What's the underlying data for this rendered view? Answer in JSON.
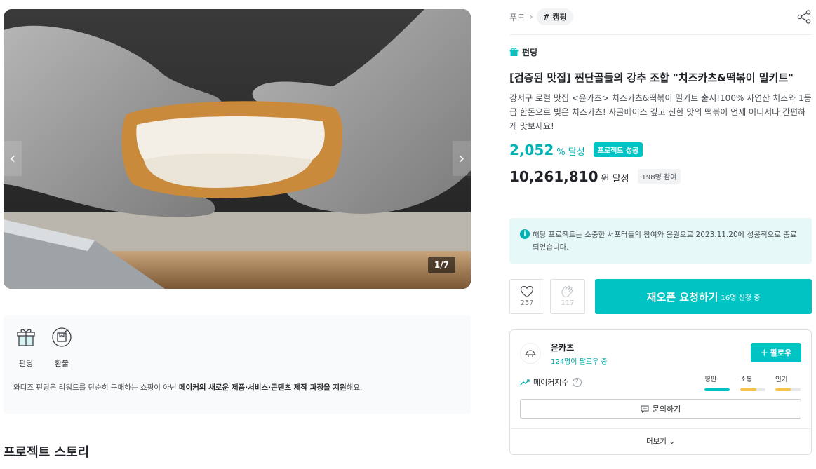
{
  "gallery": {
    "counter": "1/7",
    "prev_icon": "chevron-left-icon",
    "next_icon": "chevron-right-icon"
  },
  "info_box": {
    "icons": [
      {
        "label": "펀딩",
        "icon": "gift-icon"
      },
      {
        "label": "환불",
        "icon": "refund-icon"
      }
    ],
    "text_before": "와디즈 펀딩은 리워드를 단순히 구매하는 쇼핑이 아닌 ",
    "text_bold": "메이커의 새로운 제품·서비스·콘텐츠 제작 과정을 지원",
    "text_after": "해요."
  },
  "story_title": "프로젝트 스토리",
  "breadcrumb": {
    "category": "푸드",
    "tag": "# 캠핑"
  },
  "funding_label": "펀딩",
  "product": {
    "title": "[검증된 맛집] 찐단골들의 강추 조합 \"치즈카츠&떡볶이 밀키트\"",
    "description": "강서구 로컬 맛집 <윤카츠> 치즈카츠&떡볶이 밀키트 출시!100% 자연산 치즈와 1등급 한돈으로 빚은 치즈카츠! 사골베이스 깊고 진한 맛의 떡볶이 언제 어디서나 간편하게 맛보세요!"
  },
  "stats": {
    "percent_value": "2,052",
    "percent_unit": "% 달성",
    "success_badge": "프로젝트 성공",
    "amount_value": "10,261,810",
    "amount_unit": "원 달성",
    "participants": "198명 참여"
  },
  "notice": {
    "text": "해당 프로젝트는 소중한 서포터들의 참여와 응원으로 2023.11.20에 성공적으로 종료되었습니다."
  },
  "actions": {
    "like_count": "257",
    "cheer_count": "117",
    "rerun_label": "재오픈 요청하기",
    "rerun_sub": "16명 신청 중"
  },
  "maker": {
    "name": "윤카츠",
    "followers": "124명이 팔로우 중",
    "follow_label": "팔로우",
    "index_label": "메이커지수",
    "metrics": [
      {
        "label": "평판",
        "value": 1.0,
        "color": "#00c4c4"
      },
      {
        "label": "소통",
        "value": 0.65,
        "color": "#f5c24b"
      },
      {
        "label": "인기",
        "value": 0.6,
        "color": "#f5c24b"
      }
    ],
    "ask_label": "문의하기",
    "more_label": "더보기"
  },
  "colors": {
    "accent": "#00c4c4",
    "accent_text": "#00b2b2",
    "notice_bg": "#e7f8f8"
  }
}
